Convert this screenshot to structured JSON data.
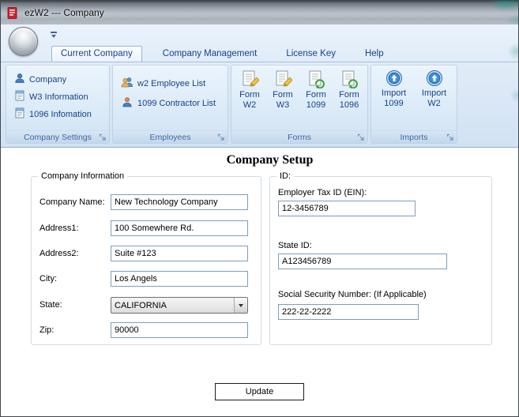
{
  "window": {
    "title": "ezW2 --- Company"
  },
  "tabs": [
    {
      "label": "Current Company",
      "active": true
    },
    {
      "label": "Company Management",
      "active": false
    },
    {
      "label": "License Key",
      "active": false
    },
    {
      "label": "Help",
      "active": false
    }
  ],
  "ribbon": {
    "company_settings": {
      "label": "Company Settings",
      "items": [
        {
          "label": "Company",
          "icon": "company-person-icon"
        },
        {
          "label": "W3 Information",
          "icon": "w3-form-icon"
        },
        {
          "label": "1096 Infomation",
          "icon": "form-1096-icon"
        }
      ]
    },
    "employees": {
      "label": "Employees",
      "items": [
        {
          "label": "w2 Employee List",
          "icon": "employee-list-icon"
        },
        {
          "label": "1099 Contractor List",
          "icon": "contractor-list-icon"
        }
      ]
    },
    "forms": {
      "label": "Forms",
      "items": [
        {
          "line1": "Form",
          "line2": "W2",
          "icon": "form-pencil-icon"
        },
        {
          "line1": "Form",
          "line2": "W3",
          "icon": "form-pencil-icon"
        },
        {
          "line1": "Form",
          "line2": "1099",
          "icon": "form-green-icon"
        },
        {
          "line1": "Form",
          "line2": "1096",
          "icon": "form-green-icon"
        }
      ]
    },
    "imports": {
      "label": "Imports",
      "items": [
        {
          "line1": "Import",
          "line2": "1099",
          "icon": "import-orb-icon"
        },
        {
          "line1": "Import",
          "line2": "W2",
          "icon": "import-orb-icon"
        }
      ]
    }
  },
  "main": {
    "title": "Company Setup",
    "company_info": {
      "legend": "Company Information",
      "company_name_label": "Company Name:",
      "company_name_value": "New Technology Company",
      "address1_label": "Address1:",
      "address1_value": "100 Somewhere Rd.",
      "address2_label": "Address2:",
      "address2_value": "Suite #123",
      "city_label": "City:",
      "city_value": "Los Angels",
      "state_label": "State:",
      "state_value": "CALIFORNIA",
      "zip_label": "Zip:",
      "zip_value": "90000"
    },
    "ids": {
      "legend": "ID:",
      "ein_label": "Employer Tax ID (EIN):",
      "ein_value": "12-3456789",
      "state_id_label": "State ID:",
      "state_id_value": "A123456789",
      "ssn_label": "Social Security Number: (If Applicable)",
      "ssn_value": "222-22-2222"
    },
    "update_button_label": "Update"
  },
  "icons": {
    "app_icon": "ezw2-red-form-icon",
    "application_menu": "application-orb-icon",
    "qat_customize": "qat-customize-caret-icon",
    "dialog_launcher": "dialog-launcher-icon",
    "state_dropdown": "dropdown-arrow-icon"
  },
  "colors": {
    "tab_text": "#15428b",
    "ribbon_group_label": "#3e68a0",
    "app_icon_red": "#cf2030",
    "textbox_border": "#7f9db9"
  }
}
